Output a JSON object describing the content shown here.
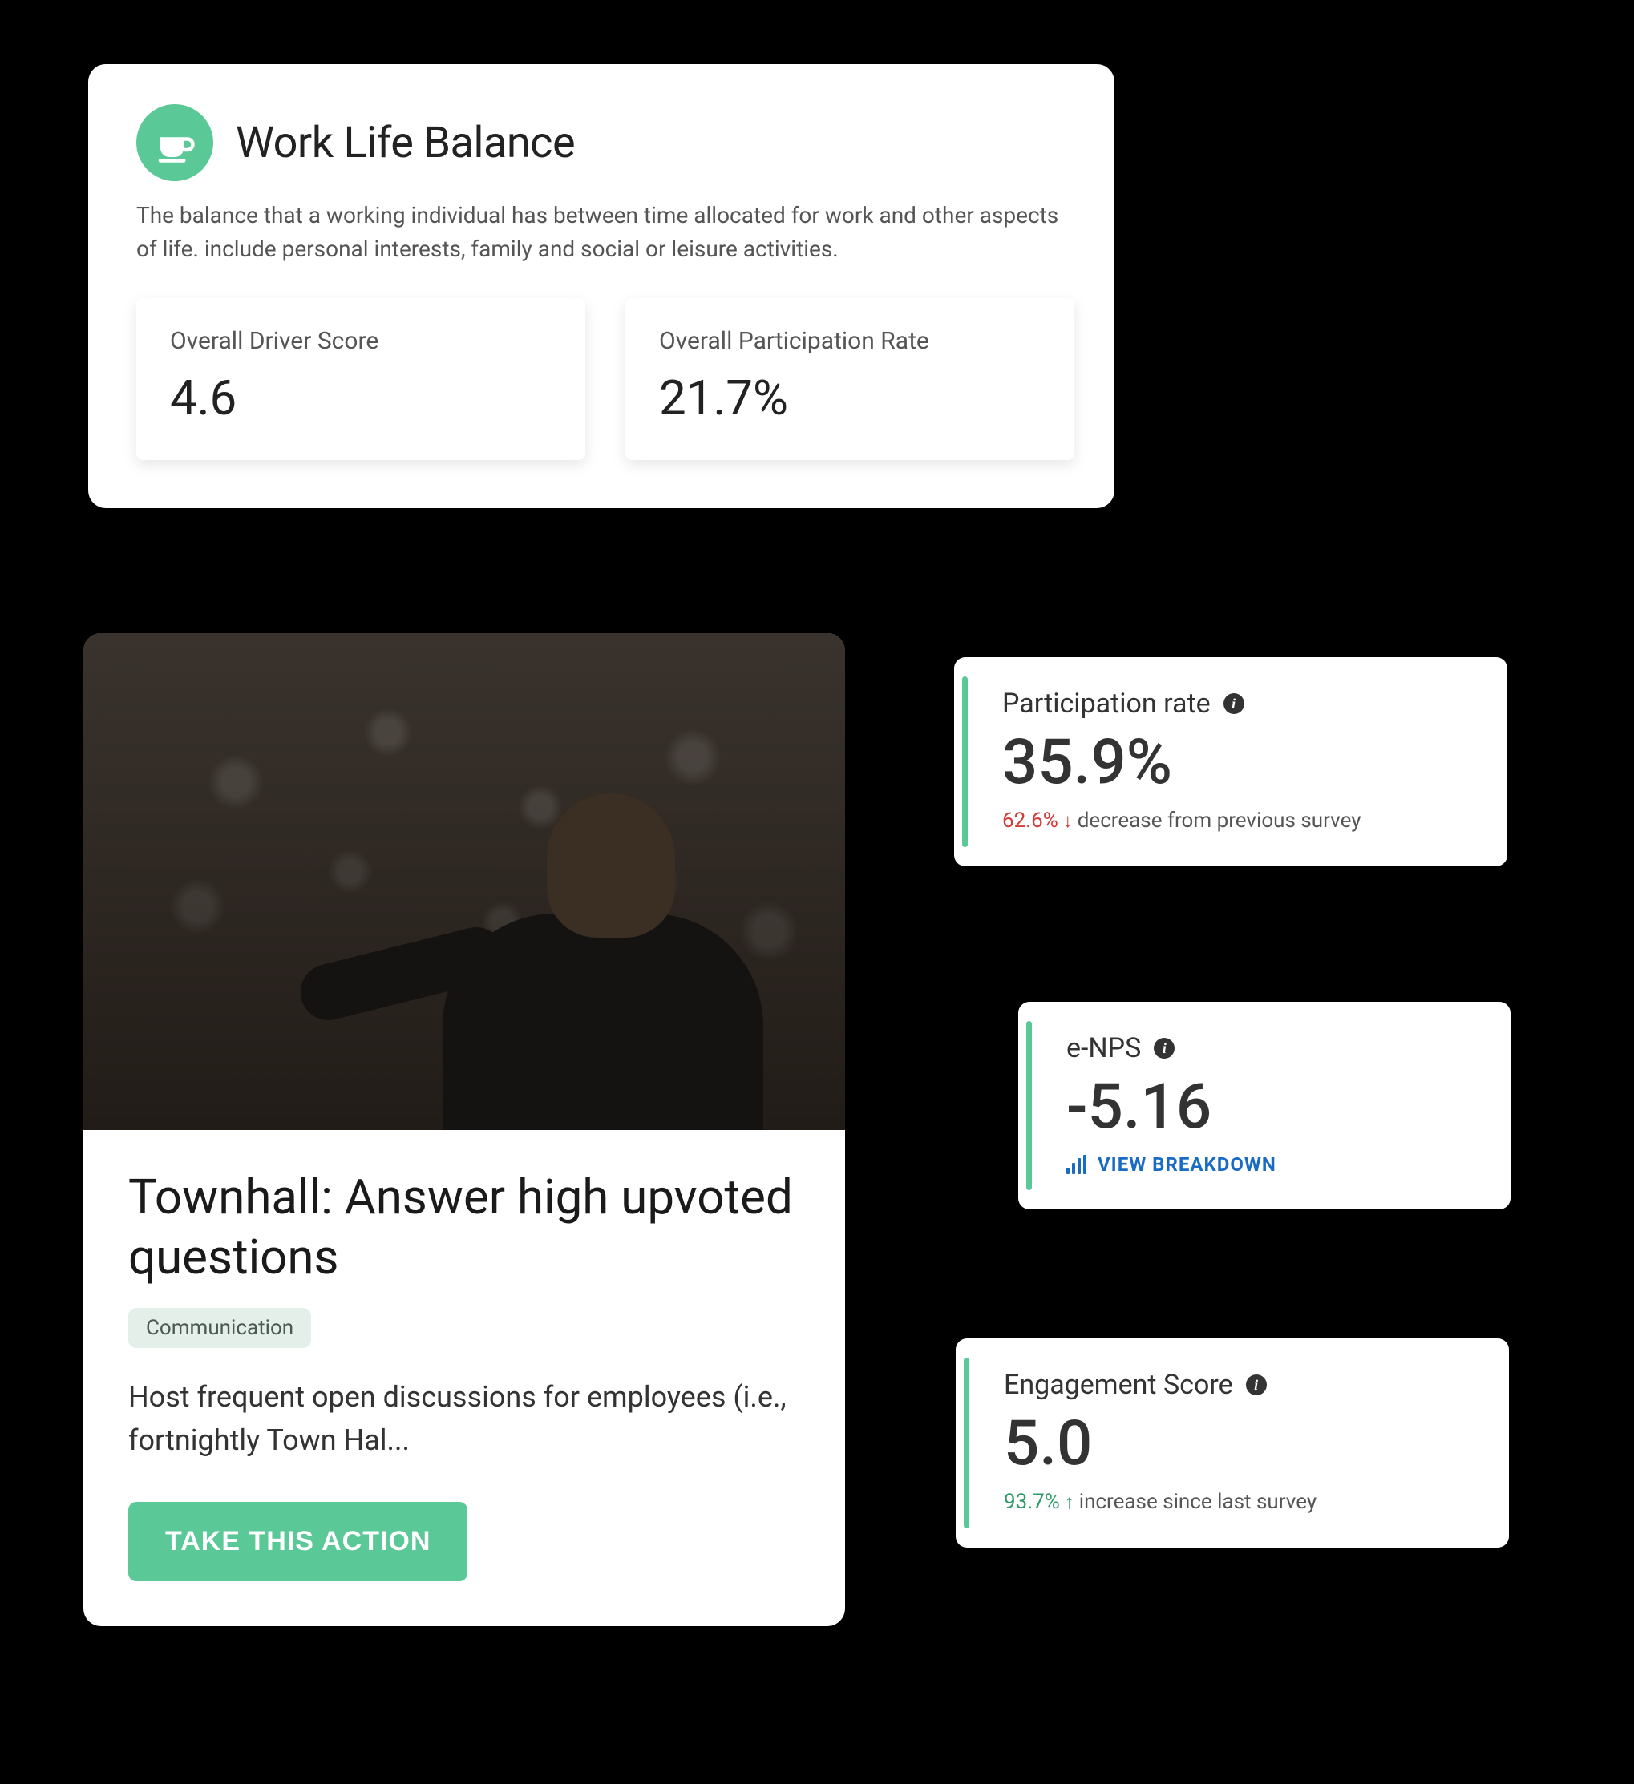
{
  "wlb": {
    "title": "Work Life Balance",
    "description": "The balance that a working individual has between time allocated for work and other aspects of life. include personal interests, family and social or leisure activities.",
    "driver_label": "Overall Driver Score",
    "driver_value": "4.6",
    "participation_label": "Overall Participation Rate",
    "participation_value": "21.7%"
  },
  "action": {
    "title": "Townhall: Answer high upvoted questions",
    "tag": "Communication",
    "description": "Host frequent open discussions for employees (i.e., fortnightly Town Hal...",
    "button": "TAKE THIS ACTION"
  },
  "stats": {
    "participation": {
      "title": "Participation rate",
      "value": "35.9%",
      "delta_pct": "62.6%",
      "delta_text": "decrease from previous survey"
    },
    "enps": {
      "title": "e-NPS",
      "value": "-5.16",
      "breakdown_label": "VIEW BREAKDOWN"
    },
    "engagement": {
      "title": "Engagement Score",
      "value": "5.0",
      "delta_pct": "93.7%",
      "delta_text": "increase since last survey"
    }
  }
}
